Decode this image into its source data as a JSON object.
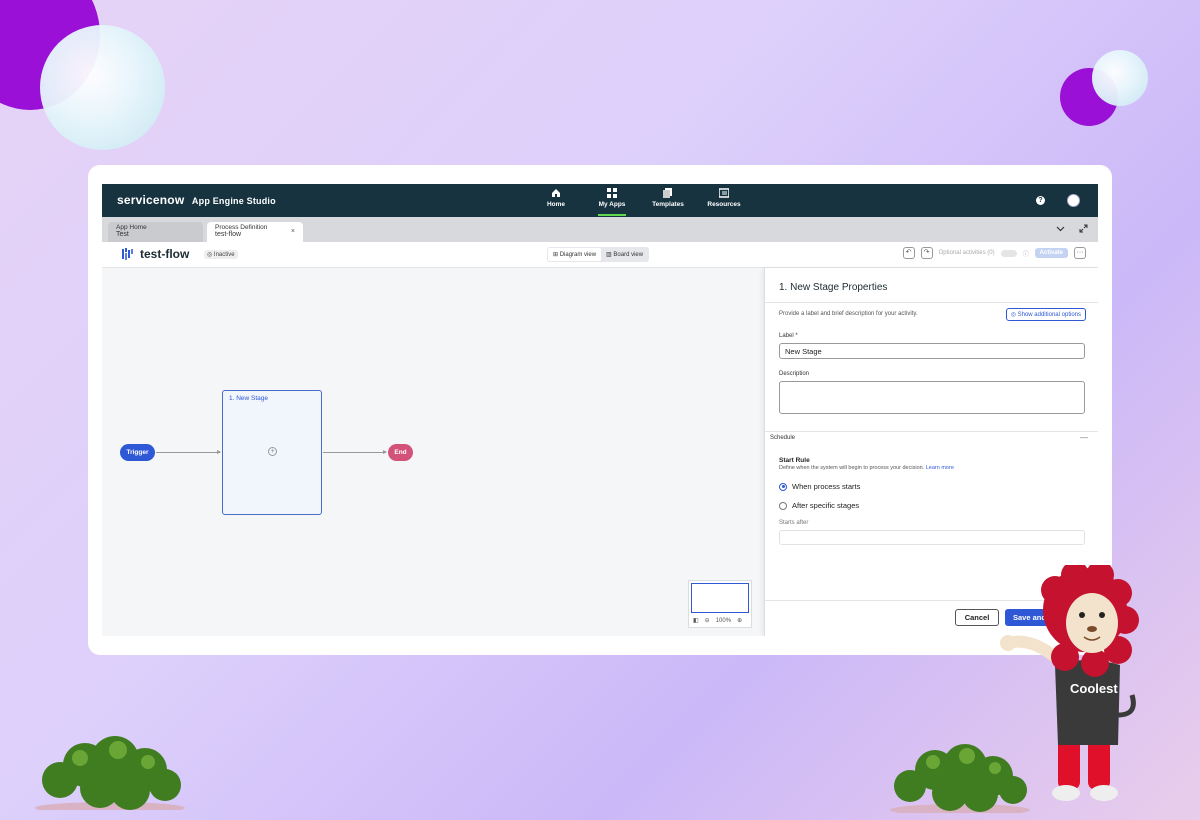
{
  "colors": {
    "nav_bg": "#173340",
    "accent": "#2e58d6",
    "end_node": "#d3527a",
    "active_underline": "#62d84e"
  },
  "topnav": {
    "brand": "servicenow",
    "product": "App Engine Studio",
    "items": [
      {
        "label": "Home",
        "icon": "home-icon"
      },
      {
        "label": "My Apps",
        "icon": "grid-icon",
        "active": true
      },
      {
        "label": "Templates",
        "icon": "templates-icon"
      },
      {
        "label": "Resources",
        "icon": "resources-icon"
      }
    ],
    "help": "?"
  },
  "tabs": [
    {
      "line1": "App Home",
      "line2": "Test"
    },
    {
      "line1": "Process Definition",
      "line2": "test-flow",
      "close": "×"
    }
  ],
  "header": {
    "title": "test-flow",
    "status": "Inactive",
    "views": [
      "Diagram view",
      "Board view"
    ],
    "options_label": "Optional activities (0)",
    "activate": "Activate",
    "more": "···"
  },
  "canvas": {
    "trigger": "Trigger",
    "stage_label": "1. New Stage",
    "end": "End",
    "zoom": "100%"
  },
  "panel": {
    "title": "1. New Stage Properties",
    "description": "Provide a label and brief description for your activity.",
    "show_options": "Show additional options",
    "label_field": {
      "label": "Label",
      "required": "*",
      "value": "New Stage"
    },
    "description_field": {
      "label": "Description"
    },
    "schedule_section": "Schedule",
    "collapse": "—",
    "start_rule": {
      "title": "Start Rule",
      "help": "Define when the system will begin to process your decision.",
      "learn_more": "Learn more",
      "options": [
        {
          "label": "When process starts",
          "selected": true
        },
        {
          "label": "After specific stages",
          "selected": false
        }
      ]
    },
    "starts_after": "Starts after",
    "cancel": "Cancel",
    "save": "Save and cl"
  }
}
